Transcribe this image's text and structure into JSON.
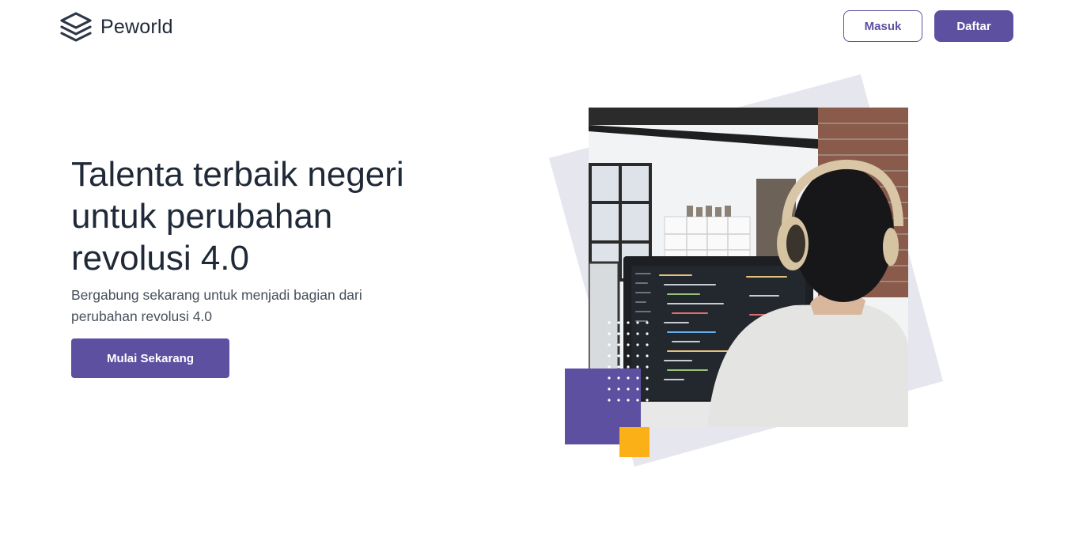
{
  "brand": {
    "name": "Peworld",
    "icon": "layers-stack-icon"
  },
  "nav": {
    "login_label": "Masuk",
    "register_label": "Daftar"
  },
  "hero": {
    "title": "Talenta terbaik negeri untuk perubahan revolusi 4.0",
    "subtitle": "Bergabung sekarang untuk menjadi bagian dari perubahan revolusi 4.0",
    "cta_label": "Mulai Sekarang",
    "image_description_icon": "developer-photo"
  },
  "colors": {
    "primary": "#5e50a1",
    "accent": "#fbb017",
    "backdrop": "#e5e6ee",
    "text": "#1f2937"
  }
}
